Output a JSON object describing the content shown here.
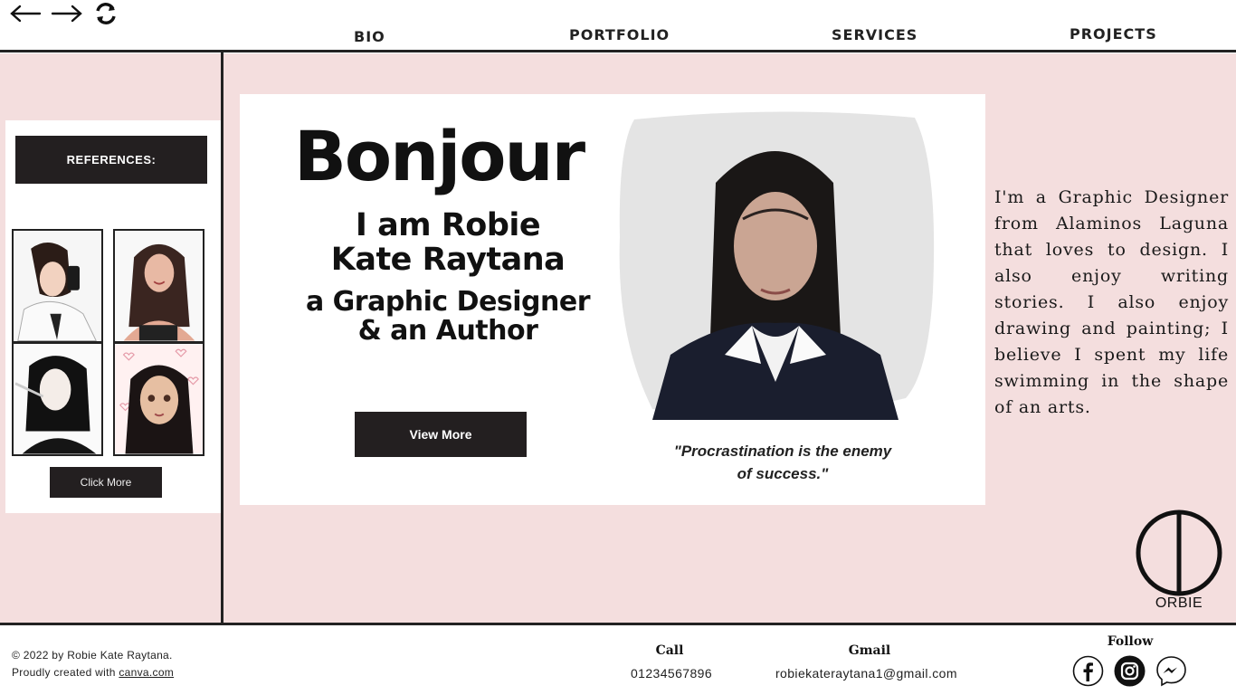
{
  "nav": {
    "links": [
      "BIO",
      "PORTFOLIO",
      "SERVICES",
      "PROJECTS"
    ]
  },
  "references": {
    "header": "REFERENCES:",
    "button": "Click More"
  },
  "hero": {
    "greeting": "Bonjour",
    "intro_line1": "I am Robie",
    "intro_line2": "Kate Raytana",
    "role_line1": "a Graphic Designer",
    "role_line2": "& an Author",
    "button": "View More",
    "quote_line1": "\"Procrastination is the enemy",
    "quote_line2": "of success.\""
  },
  "bio": {
    "text": "I'm a Graphic Designer from Alaminos Laguna that loves to design. I also enjoy writing stories. I also enjoy drawing and painting; I believe I spent my life swimming in the shape of an arts."
  },
  "logo": {
    "text": "ORBIE"
  },
  "footer": {
    "copyright": "© 2022 by Robie Kate Raytana.",
    "created_prefix": "Proudly created with",
    "created_link": "canva.com",
    "call_label": "Call",
    "call_value": "01234567896",
    "gmail_label": "Gmail",
    "gmail_value": "robiekateraytana1@gmail.com",
    "follow_label": "Follow"
  },
  "colors": {
    "pink_background": "#f4dede",
    "dark_button": "#231f20"
  },
  "icons": [
    "back-arrow-icon",
    "forward-arrow-icon",
    "refresh-icon",
    "facebook-icon",
    "instagram-icon",
    "messenger-icon"
  ]
}
